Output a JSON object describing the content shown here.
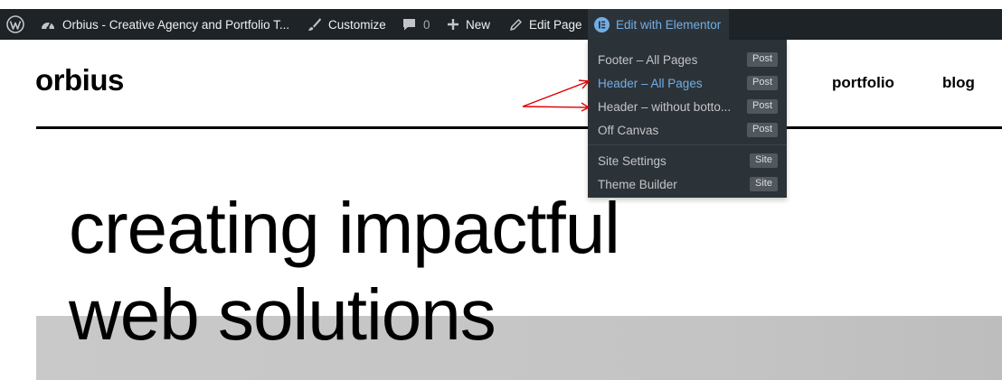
{
  "admin_bar": {
    "site_name": "Orbius - Creative Agency and Portfolio T...",
    "customize": "Customize",
    "comments_count": "0",
    "new": "New",
    "edit_page": "Edit Page",
    "edit_with_elementor": "Edit with Elementor"
  },
  "dropdown": {
    "items": [
      {
        "label": "Footer – All Pages",
        "badge": "Post"
      },
      {
        "label": "Header – All Pages",
        "badge": "Post"
      },
      {
        "label": "Header – without botto...",
        "badge": "Post"
      },
      {
        "label": "Off Canvas",
        "badge": "Post"
      }
    ],
    "settings_items": [
      {
        "label": "Site Settings",
        "badge": "Site"
      },
      {
        "label": "Theme Builder",
        "badge": "Site"
      }
    ]
  },
  "site": {
    "logo": "orbius",
    "nav": [
      "portfolio",
      "blog"
    ],
    "headline_line1": "creating impactful",
    "headline_line2": "web solutions"
  },
  "colors": {
    "admin_bar_bg": "#1d2327",
    "dropdown_bg": "#2c3338",
    "highlight": "#72aee6",
    "annotation_arrow": "#e00000"
  }
}
